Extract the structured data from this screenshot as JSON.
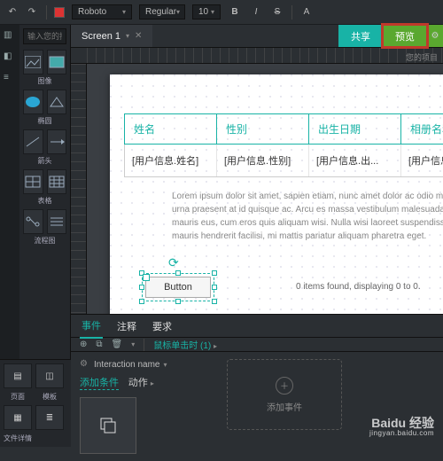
{
  "toolbar": {
    "font_family": "Roboto",
    "font_weight": "Regular",
    "font_size": "10",
    "bold": "B",
    "italic": "I",
    "strike": "S",
    "align": "A"
  },
  "left": {
    "search_placeholder": "输入您的搜索",
    "shapes": [
      {
        "label": "图像"
      },
      {
        "label": "椭圆"
      },
      {
        "label": "箭头"
      },
      {
        "label": "表格"
      },
      {
        "label": "流程图"
      }
    ],
    "bottom": [
      {
        "label": "页面"
      },
      {
        "label": "模板"
      },
      {
        "label": "文件详情"
      },
      {
        "label": ""
      }
    ]
  },
  "tabs": {
    "screen_label": "Screen 1",
    "share_label": "共享",
    "view_label": "预览",
    "note": "您的项目"
  },
  "canvas": {
    "table": {
      "headers": [
        "姓名",
        "性别",
        "出生日期",
        "相册名称"
      ],
      "cells": [
        "[用户信息.姓名]",
        "[用户信息.性别]",
        "[用户信息.出...",
        "[用户信息"
      ]
    },
    "lorem": "Lorem ipsum dolor sit amet, sapien etiam, nunc amet dolor ac odio mauris justo. Luctus arcu, urna praesent at id quisque ac. Arcu es massa vestibulum malesuada, integer vivamus elit eu mauris eus, cum eros quis aliquam wisi. Nulla wisi laoreet suspendisse integer vivamus elit eu mauris hendrerit facilisi, mi mattis pariatur aliquam pharetra eget.",
    "button_label": "Button",
    "items_found": "0 items found, displaying 0 to 0."
  },
  "bottom": {
    "tabs": {
      "events": "事件",
      "notes": "注释",
      "reqs": "要求"
    },
    "trigger": "鼠标单击时 (1)",
    "interaction_name": "Interaction name",
    "add_condition": "添加条件",
    "action": "动作",
    "add_event": "添加事件"
  },
  "watermark": {
    "brand": "Baidu 经验",
    "sub": "jingyan.baidu.com"
  }
}
